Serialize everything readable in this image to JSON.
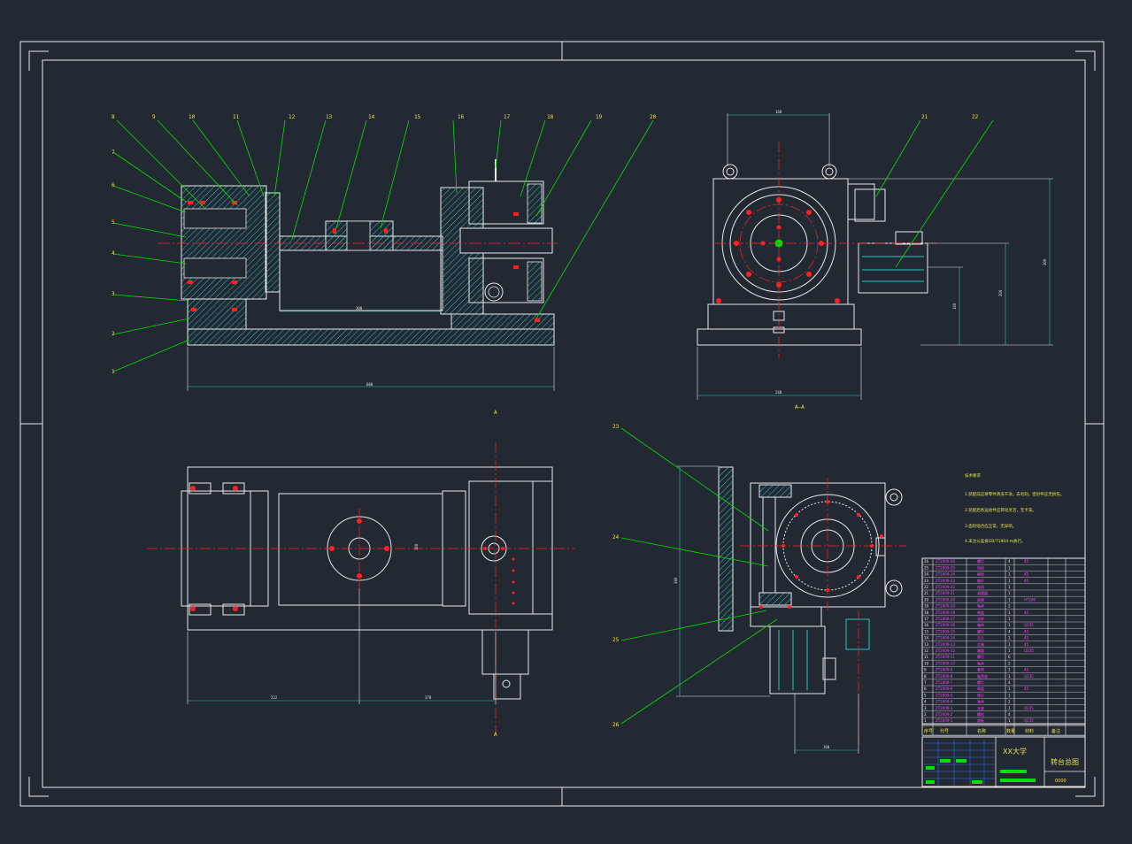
{
  "drawing": {
    "colors": {
      "background": "#222933",
      "frame": "#e8e8e8",
      "leader": "#00e000",
      "hatch": "#29c4c4",
      "center": "#ff2020",
      "magenta": "#ff44ff",
      "label": "#e8e34a"
    },
    "balloons_top": [
      "8",
      "9",
      "10",
      "11",
      "12",
      "13",
      "14",
      "15",
      "16",
      "17",
      "18",
      "19",
      "20"
    ],
    "balloons_left": [
      "7",
      "6",
      "5",
      "4",
      "3",
      "2",
      "1"
    ],
    "balloons_right": [
      "21",
      "22"
    ],
    "balloons_bottom_right": [
      "23",
      "24",
      "25",
      "26"
    ],
    "dimensions": {
      "front_overall": "600",
      "front_inner": "300",
      "side_width": "240",
      "side_top": "160",
      "side_height_a": "300",
      "side_height_b": "200",
      "side_height_c": "160",
      "plan_a": "222",
      "plan_b": "378",
      "plan_c": "160",
      "right_height": "340",
      "right_bottom": "160"
    },
    "section_label": "A—A",
    "section_marks": [
      "A",
      "A"
    ],
    "notes_title": "技术要求",
    "notes": [
      "1.装配前应将零件清洗干净，去毛刺，密封件应无损伤。",
      "2.装配后各运动件应转动灵活，无卡滞。",
      "3.齿轮啮合应正常，无异响。",
      "4.未注公差按GB/T1804-m执行。"
    ],
    "title_block": {
      "school": "XX大学",
      "title": "转台总图",
      "drawing_no": "0000"
    },
    "bom_rows": [
      {
        "code": "ZT2009-26",
        "name": "螺钉",
        "qty": "4",
        "mat": "45"
      },
      {
        "code": "ZT2009-25",
        "name": "电机",
        "qty": "1",
        "mat": ""
      },
      {
        "code": "ZT2009-24",
        "name": "蜗轮",
        "qty": "1",
        "mat": "45"
      },
      {
        "code": "ZT2009-23",
        "name": "蜗杆",
        "qty": "1",
        "mat": "45"
      },
      {
        "code": "ZT2009-22",
        "name": "电机",
        "qty": "1",
        "mat": ""
      },
      {
        "code": "ZT2009-21",
        "name": "减速器",
        "qty": "1",
        "mat": ""
      },
      {
        "code": "ZT2009-20",
        "name": "底座",
        "qty": "1",
        "mat": "HT200"
      },
      {
        "code": "ZT2009-19",
        "name": "轴承",
        "qty": "2",
        "mat": ""
      },
      {
        "code": "ZT2009-18",
        "name": "端盖",
        "qty": "1",
        "mat": "45"
      },
      {
        "code": "ZT2009-17",
        "name": "油杯",
        "qty": "1",
        "mat": ""
      },
      {
        "code": "ZT2009-16",
        "name": "箱体",
        "qty": "1",
        "mat": "Q235"
      },
      {
        "code": "ZT2009-15",
        "name": "螺钉",
        "qty": "4",
        "mat": "45"
      },
      {
        "code": "ZT2009-14",
        "name": "法兰",
        "qty": "1",
        "mat": "45"
      },
      {
        "code": "ZT2009-13",
        "name": "主轴",
        "qty": "1",
        "mat": "45"
      },
      {
        "code": "ZT2009-12",
        "name": "端盖",
        "qty": "1",
        "mat": "Q235"
      },
      {
        "code": "ZT2009-11",
        "name": "螺钉",
        "qty": "6",
        "mat": ""
      },
      {
        "code": "ZT2009-10",
        "name": "轴承",
        "qty": "2",
        "mat": ""
      },
      {
        "code": "ZT2009-9",
        "name": "套筒",
        "qty": "1",
        "mat": "45"
      },
      {
        "code": "ZT2009-8",
        "name": "轴承座",
        "qty": "1",
        "mat": "Q235"
      },
      {
        "code": "ZT2009-7",
        "name": "螺钉",
        "qty": "4",
        "mat": ""
      },
      {
        "code": "ZT2009-6",
        "name": "端盖",
        "qty": "1",
        "mat": "45"
      },
      {
        "code": "ZT2009-5",
        "name": "垫片",
        "qty": "1",
        "mat": ""
      },
      {
        "code": "ZT2009-4",
        "name": "轴承",
        "qty": "2",
        "mat": ""
      },
      {
        "code": "ZT2009-3",
        "name": "支座",
        "qty": "1",
        "mat": "Q235"
      },
      {
        "code": "ZT2009-2",
        "name": "螺栓",
        "qty": "4",
        "mat": ""
      },
      {
        "code": "ZT2009-1",
        "name": "底板",
        "qty": "1",
        "mat": "Q235"
      }
    ],
    "bom_header": [
      "序号",
      "代号",
      "名称",
      "数量",
      "材料",
      "备注"
    ]
  }
}
